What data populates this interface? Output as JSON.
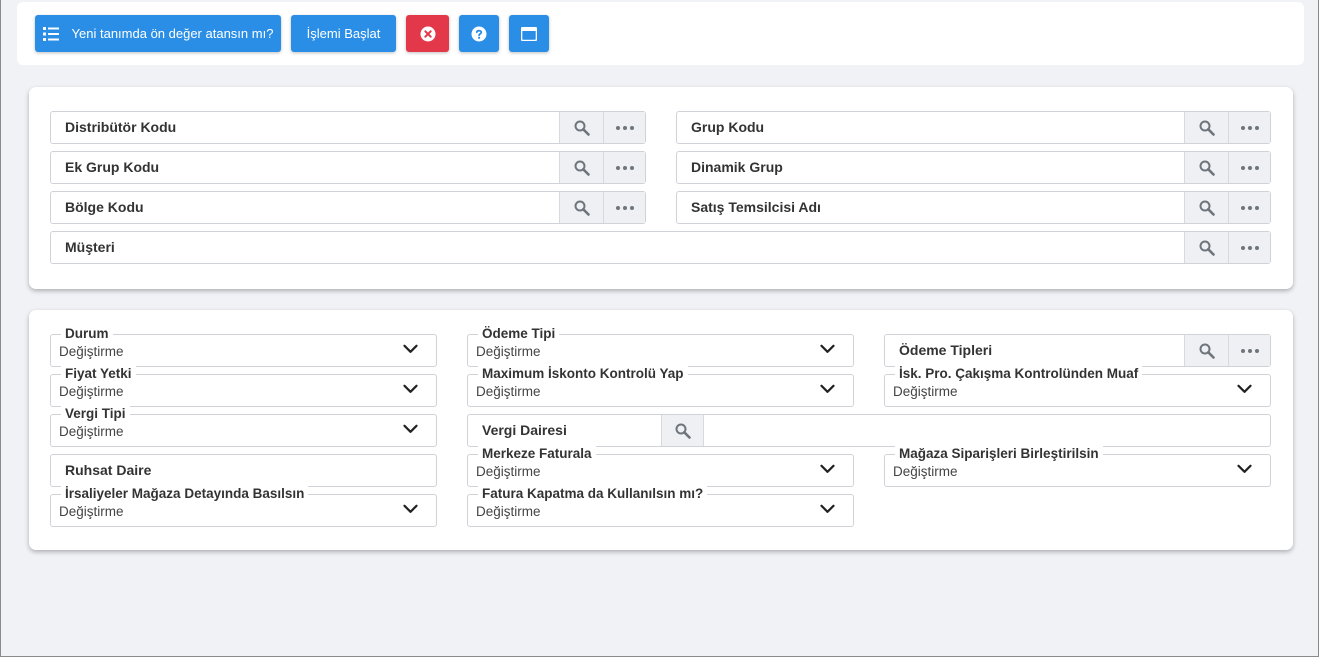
{
  "toolbar": {
    "default_button_label": "Yeni tanımda ön değer atansın mı?",
    "start_button_label": "İşlemi Başlat"
  },
  "filters": {
    "distributor": "Distribütör Kodu",
    "group": "Grup Kodu",
    "extra_group": "Ek Grup Kodu",
    "dynamic_group": "Dinamik Grup",
    "region": "Bölge Kodu",
    "sales_rep": "Satış Temsilcisi Adı",
    "customer": "Müşteri"
  },
  "settings": {
    "status": {
      "label": "Durum",
      "value": "Değiştirme"
    },
    "payment_type": {
      "label": "Ödeme Tipi",
      "value": "Değiştirme"
    },
    "payment_types": "Ödeme Tipleri",
    "price_auth": {
      "label": "Fiyat Yetki",
      "value": "Değiştirme"
    },
    "max_discount": {
      "label": "Maximum İskonto Kontrolü Yap",
      "value": "Değiştirme"
    },
    "conflict_exempt": {
      "label": "İsk. Pro. Çakışma Kontrolünden Muaf",
      "value": "Değiştirme"
    },
    "tax_type": {
      "label": "Vergi Tipi",
      "value": "Değiştirme"
    },
    "tax_office": "Vergi Dairesi",
    "license_office": "Ruhsat Daire",
    "invoice_hq": {
      "label": "Merkeze Faturala",
      "value": "Değiştirme"
    },
    "merge_orders": {
      "label": "Mağaza Siparişleri Birleştirilsin",
      "value": "Değiştirme"
    },
    "waybill_print": {
      "label": "İrsaliyeler Mağaza Detayında Basılsın",
      "value": "Değiştirme"
    },
    "invoice_close": {
      "label": "Fatura Kapatma da Kullanılsın mı?",
      "value": "Değiştirme"
    }
  },
  "colors": {
    "primary": "#2a8ee6",
    "danger": "#e33849",
    "background": "#f1f2f6"
  },
  "icons": [
    "list-icon",
    "close-circle-icon",
    "help-circle-icon",
    "window-icon",
    "search-icon",
    "more-dots-icon",
    "chevron-down-icon"
  ]
}
